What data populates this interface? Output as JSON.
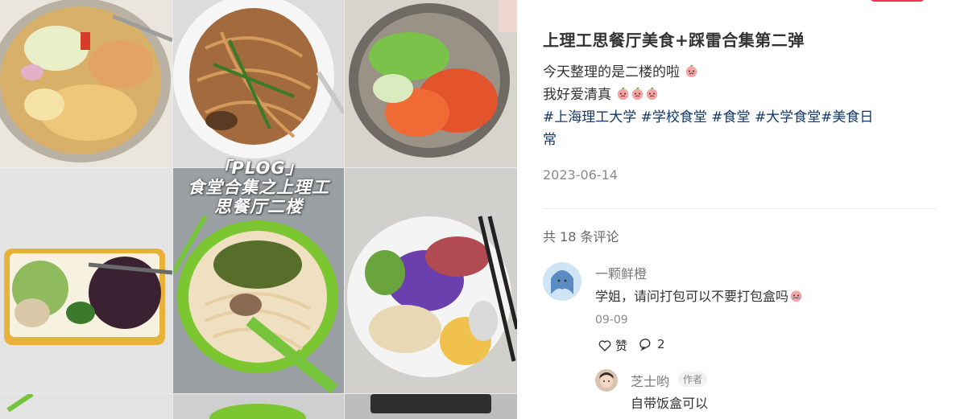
{
  "media": {
    "overlay_lines": [
      "「PLOG」",
      "食堂合集之上理工",
      "思餐厅二楼"
    ],
    "photos": [
      {
        "name": "cabbage-chicken-bowl-photo",
        "bg": "#c8a56a"
      },
      {
        "name": "fried-noodles-photo",
        "bg": "#8a5a33"
      },
      {
        "name": "sweet-sour-pork-photo",
        "bg": "#c9542e"
      },
      {
        "name": "purple-rice-box-photo",
        "bg": "#e9b63b"
      },
      {
        "name": "pickled-noodle-soup-photo",
        "bg": "#7cc631"
      },
      {
        "name": "purple-potato-plate-photo",
        "bg": "#f3f3f3"
      }
    ]
  },
  "post": {
    "title": "上理工思餐厅美食+踩雷合集第二弹",
    "line1": "今天整理的是二楼的啦",
    "line2": "我好爱清真",
    "tags_line1": "#上海理工大学 #学校食堂 #食堂 #大学食堂#美食日",
    "tags_line2": "常",
    "date": "2023-06-14"
  },
  "comments": {
    "count_label": "共 18 条评论",
    "items": [
      {
        "user": "一颗鲜橙",
        "text": "学姐，请问打包可以不要打包盒吗",
        "date": "09-09",
        "like_label": "赞",
        "reply_count": "2"
      }
    ],
    "reply": {
      "user": "芝士哟",
      "badge": "作者",
      "text": "自带饭盒可以"
    }
  },
  "colors": {
    "tag": "#13386c",
    "accent": "#ff2e4d",
    "muted": "#8a8a8a"
  }
}
